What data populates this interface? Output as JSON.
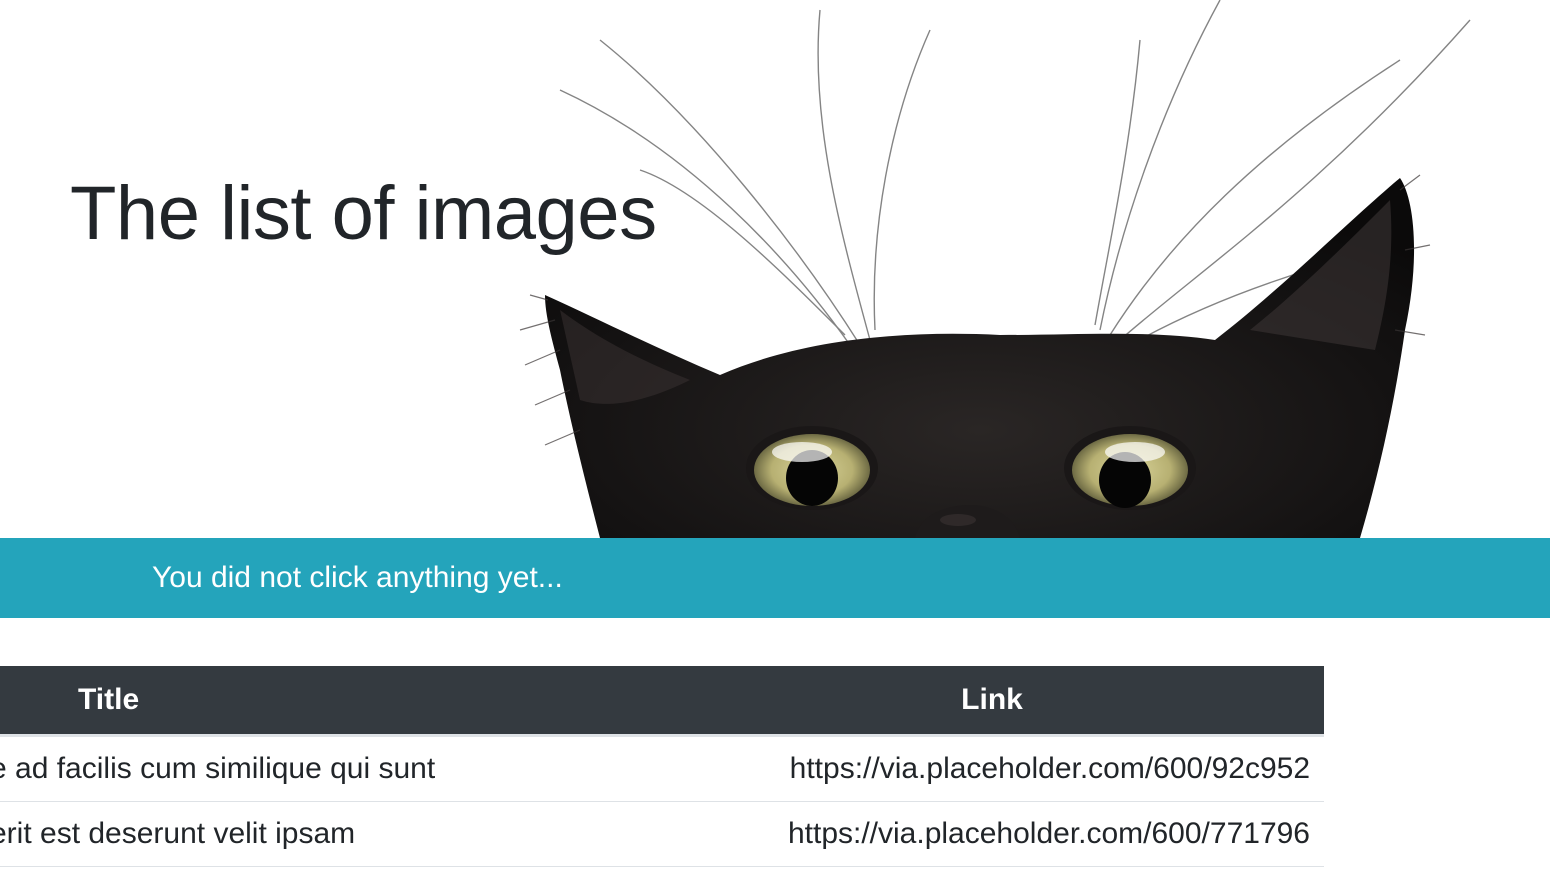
{
  "hero": {
    "title": "The list of images"
  },
  "alert": {
    "message": "You did not click anything yet..."
  },
  "table": {
    "headers": [
      "Title",
      "Link"
    ],
    "rows": [
      {
        "title": "e ad facilis cum similique qui sunt",
        "link": "https://via.placeholder.com/600/92c952"
      },
      {
        "title": "erit est deserunt velit ipsam",
        "link": "https://via.placeholder.com/600/771796"
      }
    ]
  },
  "colors": {
    "alert_background": "#24a4bb",
    "table_header_background": "#343a40",
    "text": "#212529"
  }
}
